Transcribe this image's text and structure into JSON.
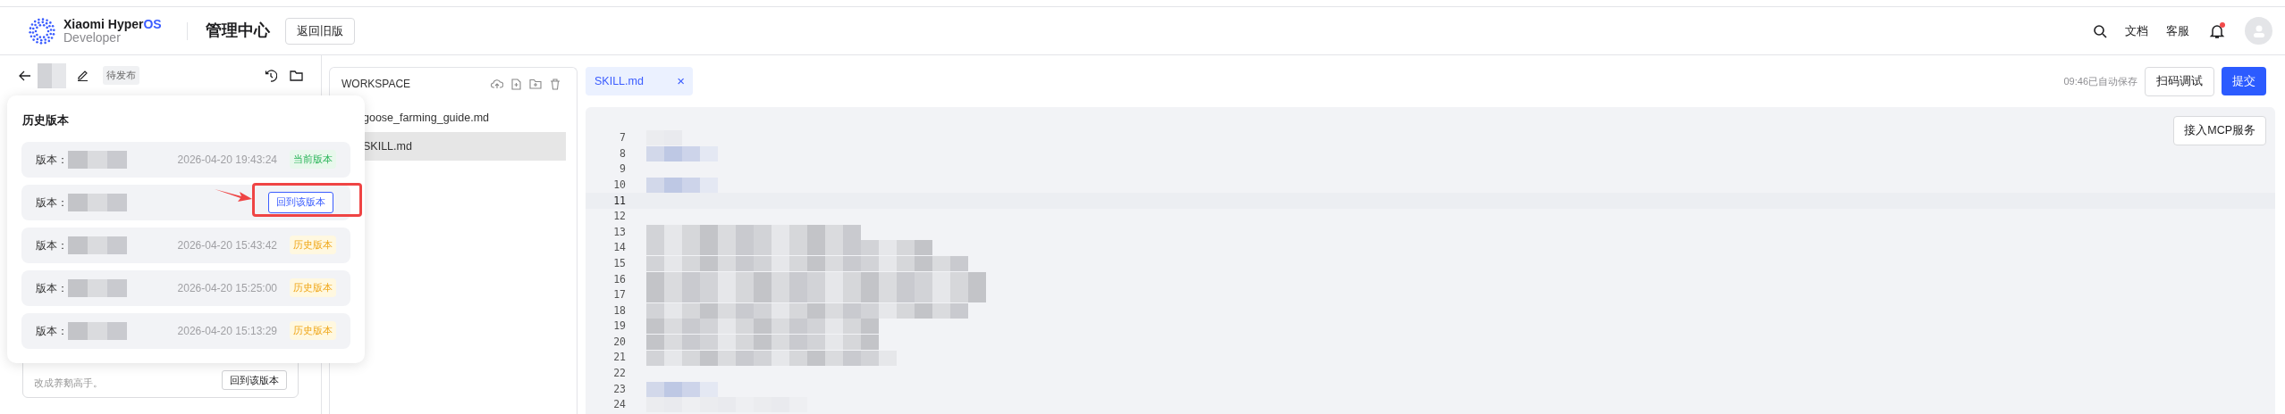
{
  "header": {
    "brand_main": "Xiaomi Hyper",
    "brand_accent": "OS",
    "brand_sub": "Developer",
    "title": "管理中心",
    "back_button": "返回旧版",
    "links": [
      "文档",
      "客服"
    ],
    "has_notification": true
  },
  "document": {
    "status_tag": "待发布",
    "footer_text": "改成养鹅高手。",
    "footer_button": "回到该版本"
  },
  "history": {
    "title": "历史版本",
    "versions": [
      {
        "kind": "status",
        "label": "版本：",
        "date": "2026-04-20 19:43:24",
        "badge": {
          "text": "当前版本",
          "kind": "current"
        },
        "highlighted": false
      },
      {
        "kind": "restore",
        "label": "版本：",
        "action": "回到该版本",
        "highlighted": true
      },
      {
        "kind": "status",
        "label": "版本：",
        "date": "2026-04-20 15:43:42",
        "badge": {
          "text": "历史版本",
          "kind": "history"
        },
        "highlighted": false
      },
      {
        "kind": "status",
        "label": "版本：",
        "date": "2026-04-20 15:25:00",
        "badge": {
          "text": "历史版本",
          "kind": "history"
        },
        "highlighted": false
      },
      {
        "kind": "status",
        "label": "版本：",
        "date": "2026-04-20 15:13:29",
        "badge": {
          "text": "历史版本",
          "kind": "history"
        },
        "highlighted": false
      }
    ]
  },
  "workspace": {
    "title": "WORKSPACE",
    "files": [
      {
        "name": "goose_farming_guide.md",
        "selected": false
      },
      {
        "name": "SKILL.md",
        "selected": true
      }
    ]
  },
  "editor": {
    "tab": "SKILL.md",
    "tab_close": "×",
    "autosave": "09:46已自动保存",
    "scan_button": "扫码调试",
    "submit_button": "提交",
    "mcp_button": "接入MCP服务",
    "lines": [
      {
        "number": "7",
        "active": false
      },
      {
        "number": "8",
        "active": false
      },
      {
        "number": "9",
        "active": false
      },
      {
        "number": "10",
        "active": false
      },
      {
        "number": "11",
        "active": true
      },
      {
        "number": "12",
        "active": false
      },
      {
        "number": "13",
        "active": false
      },
      {
        "number": "14",
        "active": false
      },
      {
        "number": "15",
        "active": false
      },
      {
        "number": "16",
        "active": false
      },
      {
        "number": "17",
        "active": false
      },
      {
        "number": "18",
        "active": false
      },
      {
        "number": "19",
        "active": false
      },
      {
        "number": "20",
        "active": false
      },
      {
        "number": "21",
        "active": false
      },
      {
        "number": "22",
        "active": false
      },
      {
        "number": "23",
        "active": false
      },
      {
        "number": "24",
        "active": false
      }
    ]
  }
}
